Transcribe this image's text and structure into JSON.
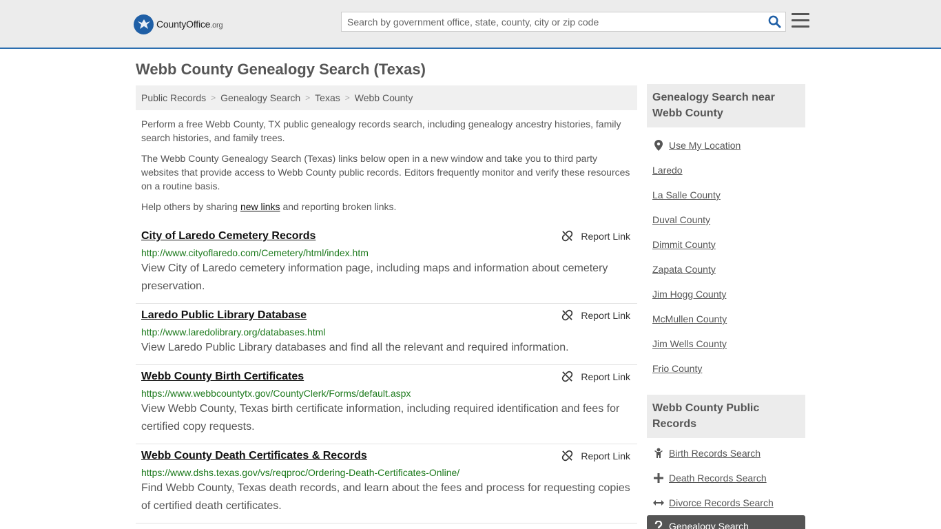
{
  "header": {
    "logo_main": "CountyOffice",
    "logo_tld": ".org",
    "search_placeholder": "Search by government office, state, county, city or zip code"
  },
  "page_title": "Webb County Genealogy Search (Texas)",
  "breadcrumb": [
    {
      "label": "Public Records"
    },
    {
      "label": "Genealogy Search"
    },
    {
      "label": "Texas"
    },
    {
      "label": "Webb County"
    }
  ],
  "intro": {
    "p1": "Perform a free Webb County, TX public genealogy records search, including genealogy ancestry histories, family search histories, and family trees.",
    "p2": "The Webb County Genealogy Search (Texas) links below open in a new window and take you to third party websites that provide access to Webb County public records. Editors frequently monitor and verify these resources on a routine basis.",
    "p3_before": "Help others by sharing ",
    "p3_link": "new links",
    "p3_after": " and reporting broken links."
  },
  "report_label": "Report Link",
  "results": [
    {
      "title": "City of Laredo Cemetery Records",
      "url": "http://www.cityoflaredo.com/Cemetery/html/index.htm",
      "desc": "View City of Laredo cemetery information page, including maps and information about cemetery preservation."
    },
    {
      "title": "Laredo Public Library Database",
      "url": "http://www.laredolibrary.org/databases.html",
      "desc": "View Laredo Public Library databases and find all the relevant and required information."
    },
    {
      "title": "Webb County Birth Certificates",
      "url": "https://www.webbcountytx.gov/CountyClerk/Forms/default.aspx",
      "desc": "View Webb County, Texas birth certificate information, including required identification and fees for certified copy requests."
    },
    {
      "title": "Webb County Death Certificates & Records",
      "url": "https://www.dshs.texas.gov/vs/reqproc/Ordering-Death-Certificates-Online/",
      "desc": "Find Webb County, Texas death records, and learn about the fees and process for requesting copies of certified death certificates."
    }
  ],
  "sidebar": {
    "near_title": "Genealogy Search near Webb County",
    "use_location": "Use My Location",
    "near_items": [
      "Laredo",
      "La Salle County",
      "Duval County",
      "Dimmit County",
      "Zapata County",
      "Jim Hogg County",
      "McMullen County",
      "Jim Wells County",
      "Frio County"
    ],
    "records_title": "Webb County Public Records",
    "records_items": [
      {
        "label": "Birth Records Search",
        "icon": "birth-icon"
      },
      {
        "label": "Death Records Search",
        "icon": "plus-icon"
      },
      {
        "label": "Divorce Records Search",
        "icon": "arrows-icon"
      },
      {
        "label": "Genealogy Search",
        "icon": "question-icon"
      }
    ]
  },
  "colors": {
    "accent": "#2c6fb0",
    "url_green": "#1d7a1d",
    "search_icon": "#1f5fa6"
  }
}
